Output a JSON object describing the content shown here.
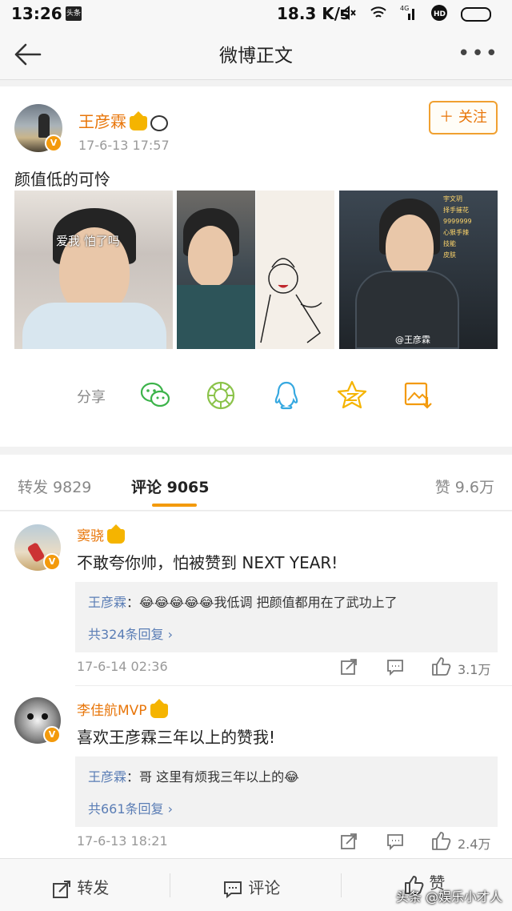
{
  "status_bar": {
    "time": "13:26",
    "news_badge": "头条",
    "net_speed": "18.3 K/s",
    "signal_label": "4G",
    "hd_label": "HD"
  },
  "nav": {
    "title": "微博正文",
    "back_icon": "arrow-left-icon",
    "more_icon": "more-dots-icon"
  },
  "post": {
    "author": "王彦霖",
    "time": "17-6-13 17:57",
    "follow_label": "关注",
    "text": "颜值低的可怜",
    "image1_caption": "爱我 怕了吗",
    "image4_watermark": "@王彦霖",
    "image4_hud": [
      "宇文玥",
      "择手摧花",
      "9999999",
      "心狠手辣",
      "技能",
      "皮肤"
    ],
    "share_label": "分享",
    "share_icons": [
      "wechat-icon",
      "moments-icon",
      "qq-icon",
      "qzone-icon",
      "save-image-icon"
    ]
  },
  "tabs": {
    "repost": "转发 9829",
    "comment": "评论 9065",
    "likes": "赞 9.6万"
  },
  "comments": [
    {
      "name": "窦骁",
      "body": "不敢夸你帅，怕被赞到 NEXT YEAR!",
      "reply_name": "王彦霖",
      "reply_text": "：😂😂😂😂😂我低调 把颜值都用在了武功上了",
      "reply_more": "共324条回复 ›",
      "date": "17-6-14 02:36",
      "likes": "3.1万"
    },
    {
      "name": "李佳航MVP",
      "body": "喜欢王彦霖三年以上的赞我!",
      "reply_name": "王彦霖",
      "reply_text": "：哥 这里有烦我三年以上的😂",
      "reply_more": "共661条回复 ›",
      "date": "17-6-13 18:21",
      "likes": "2.4万"
    }
  ],
  "bottom_bar": {
    "repost": "转发",
    "comment": "评论",
    "like": "赞",
    "watermark": "头条 @娱乐小才人"
  },
  "colors": {
    "accent": "#f39a0c",
    "name": "#e8760a",
    "link": "#5a7db5"
  }
}
